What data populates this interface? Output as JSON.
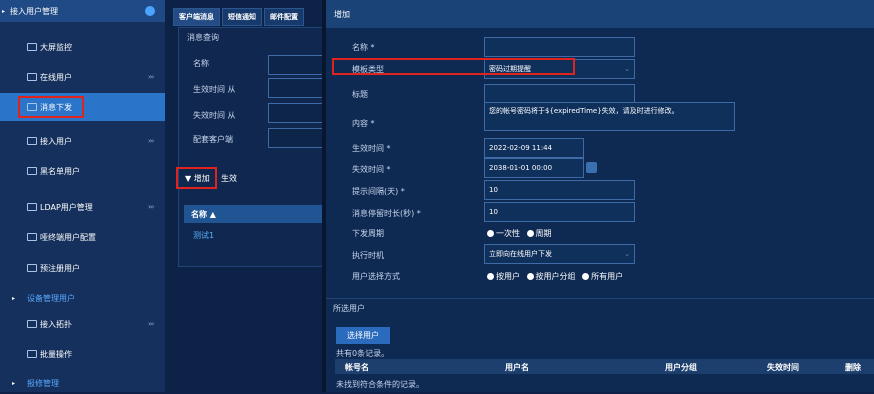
{
  "sidebar": {
    "header": "接入用户管理",
    "items": [
      {
        "label": "大屏监控",
        "icon": "monitor-icon",
        "chev": ""
      },
      {
        "label": "在线用户",
        "icon": "users-icon",
        "chev": "›››"
      },
      {
        "label": "消息下发",
        "icon": "message-icon",
        "chev": ""
      },
      {
        "label": "接入用户",
        "icon": "user-icon",
        "chev": "›››"
      },
      {
        "label": "黑名单用户",
        "icon": "blacklist-icon",
        "chev": ""
      },
      {
        "label": "LDAP用户管理",
        "icon": "ldap-icon",
        "chev": "›››"
      },
      {
        "label": "哑终端用户配置",
        "icon": "terminal-icon",
        "chev": ""
      },
      {
        "label": "预注册用户",
        "icon": "register-icon",
        "chev": ""
      }
    ],
    "group1": "设备管理用户",
    "items2": [
      {
        "label": "接入拓扑",
        "icon": "topology-icon",
        "chev": "›››"
      },
      {
        "label": "批量操作",
        "icon": "batch-icon",
        "chev": ""
      }
    ],
    "group2": "报修管理"
  },
  "tabs": [
    "客户端消息",
    "短信通知",
    "邮件配置"
  ],
  "query": {
    "title": "消息查询",
    "fields": [
      "名称",
      "生效时间 从",
      "失效时间 从",
      "配套客户端"
    ],
    "add_btn": "▼ 增加",
    "effect_btn": "生效",
    "table_header": "名称 ▲",
    "row1": "测试1"
  },
  "form": {
    "title": "增加",
    "labels": {
      "name": "名称 *",
      "template": "模板类型",
      "subject": "标题",
      "content": "内容 *",
      "effective": "生效时间 *",
      "expire": "失效时间 *",
      "remind": "提示间隔(天) *",
      "stay": "消息停留时长(秒) *",
      "cycle": "下发周期",
      "exec": "执行时机",
      "select_mode": "用户选择方式"
    },
    "template_value": "密码过期提醒",
    "content_value": "您的帐号密码将于${expiredTime}失效，请及时进行修改。",
    "effective_value": "2022-02-09 11:44",
    "expire_value": "2038-01-01 00:00",
    "remind_value": "10",
    "stay_value": "10",
    "cycle_options": [
      "一次性",
      "周期"
    ],
    "exec_value": "立即向在线用户下发",
    "select_options": [
      "按用户",
      "按用户分组",
      "所有用户"
    ]
  },
  "selected_users": {
    "title": "所选用户",
    "select_btn": "选择用户",
    "count": "共有0条记录。",
    "columns": [
      "帐号名",
      "用户名",
      "用户分组",
      "失效时间",
      "删除"
    ],
    "empty": "未找到符合条件的记录。"
  }
}
